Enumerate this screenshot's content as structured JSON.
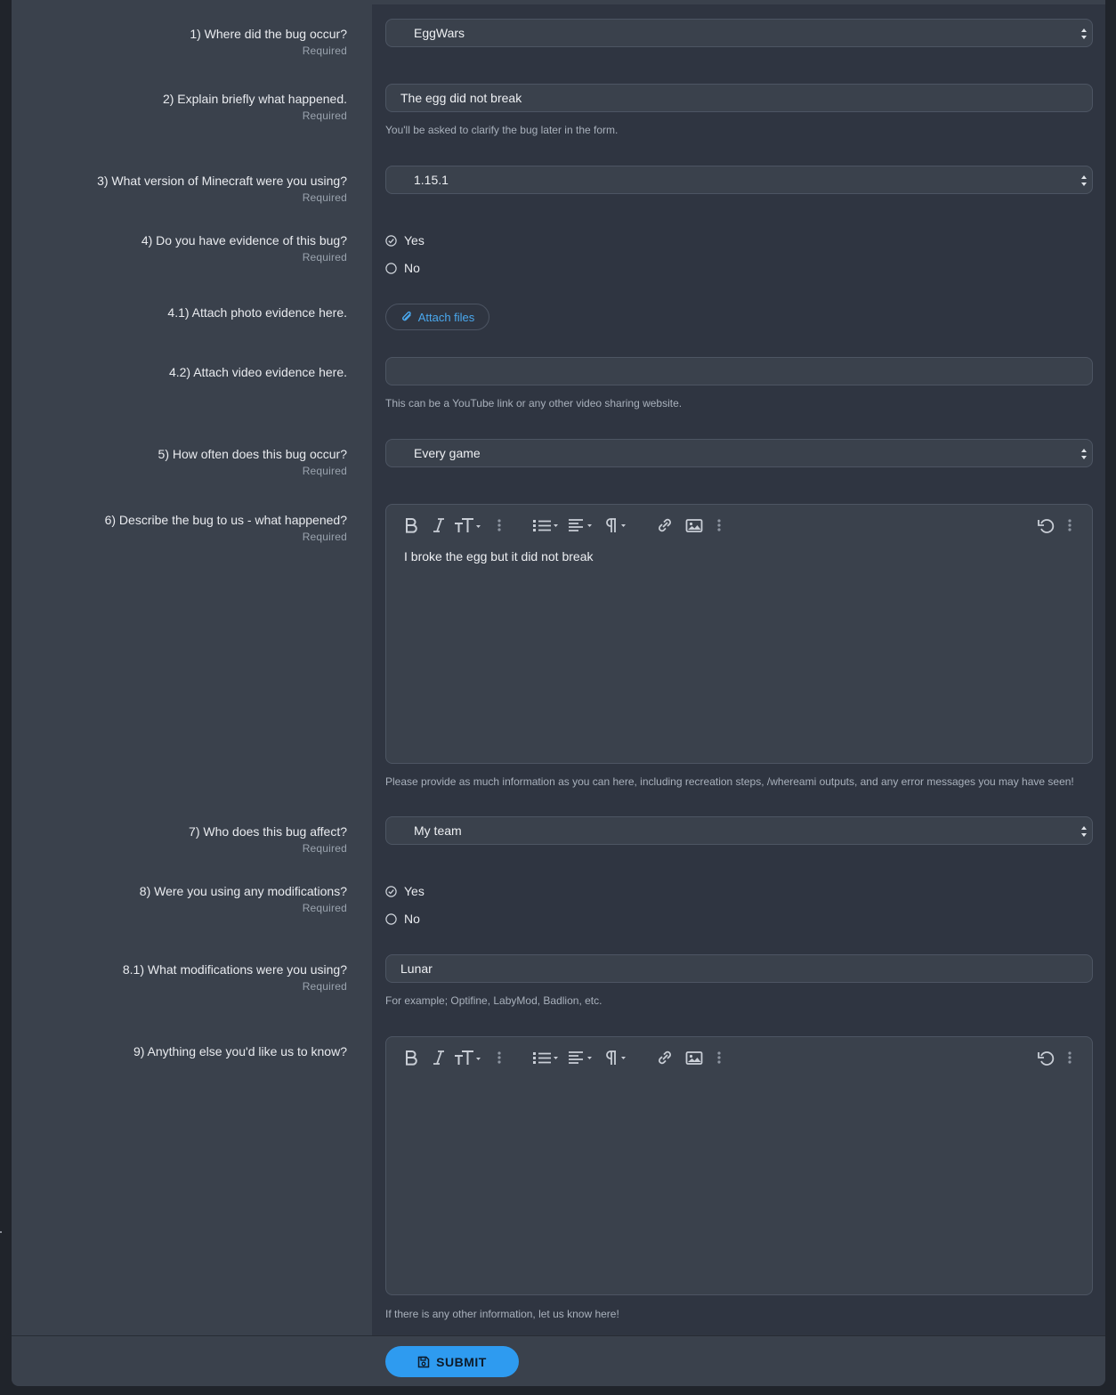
{
  "form": {
    "questions": [
      {
        "label": "1) Where did the bug occur?",
        "required": "Required",
        "type": "select",
        "value": "EggWars"
      },
      {
        "label": "2) Explain briefly what happened.",
        "required": "Required",
        "type": "input",
        "value": "The egg did not break",
        "hint": "You'll be asked to clarify the bug later in the form."
      },
      {
        "label": "3) What version of Minecraft were you using?",
        "required": "Required",
        "type": "select",
        "value": "1.15.1"
      },
      {
        "label": "4) Do you have evidence of this bug?",
        "required": "Required",
        "type": "radio",
        "options": [
          "Yes",
          "No"
        ],
        "selected": "Yes"
      },
      {
        "label": "4.1) Attach photo evidence here.",
        "type": "attach",
        "button": "Attach files"
      },
      {
        "label": "4.2) Attach video evidence here.",
        "type": "input",
        "value": "",
        "hint": "This can be a YouTube link or any other video sharing website."
      },
      {
        "label": "5) How often does this bug occur?",
        "required": "Required",
        "type": "select",
        "value": "Every game"
      },
      {
        "label": "6) Describe the bug to us - what happened?",
        "required": "Required",
        "type": "editor",
        "value": "I broke the egg but it did not break",
        "hint": "Please provide as much information as you can here, including recreation steps, /whereami outputs, and any error messages you may have seen!"
      },
      {
        "label": "7) Who does this bug affect?",
        "required": "Required",
        "type": "select",
        "value": "My team"
      },
      {
        "label": "8) Were you using any modifications?",
        "required": "Required",
        "type": "radio",
        "options": [
          "Yes",
          "No"
        ],
        "selected": "Yes"
      },
      {
        "label": "8.1) What modifications were you using?",
        "required": "Required",
        "type": "input",
        "value": "Lunar",
        "hint": "For example; Optifine, LabyMod, Badlion, etc."
      },
      {
        "label": "9) Anything else you'd like us to know?",
        "type": "editor",
        "value": "",
        "hint": "If there is any other information, let us know here!"
      }
    ],
    "submit_label": "SUBMIT"
  },
  "editor_toolbar": {
    "icons": [
      "bold-icon",
      "italic-icon",
      "text-size-icon",
      "more-vertical-icon",
      "list-icon",
      "align-icon",
      "paragraph-icon",
      "more-vertical-icon",
      "link-icon",
      "image-icon",
      "more-vertical-icon",
      "undo-icon",
      "more-vertical-icon"
    ]
  },
  "colors": {
    "accent": "#2e9bf0",
    "link": "#4aa8ee",
    "panel": "#2f3541",
    "label_column": "#3a414c"
  }
}
